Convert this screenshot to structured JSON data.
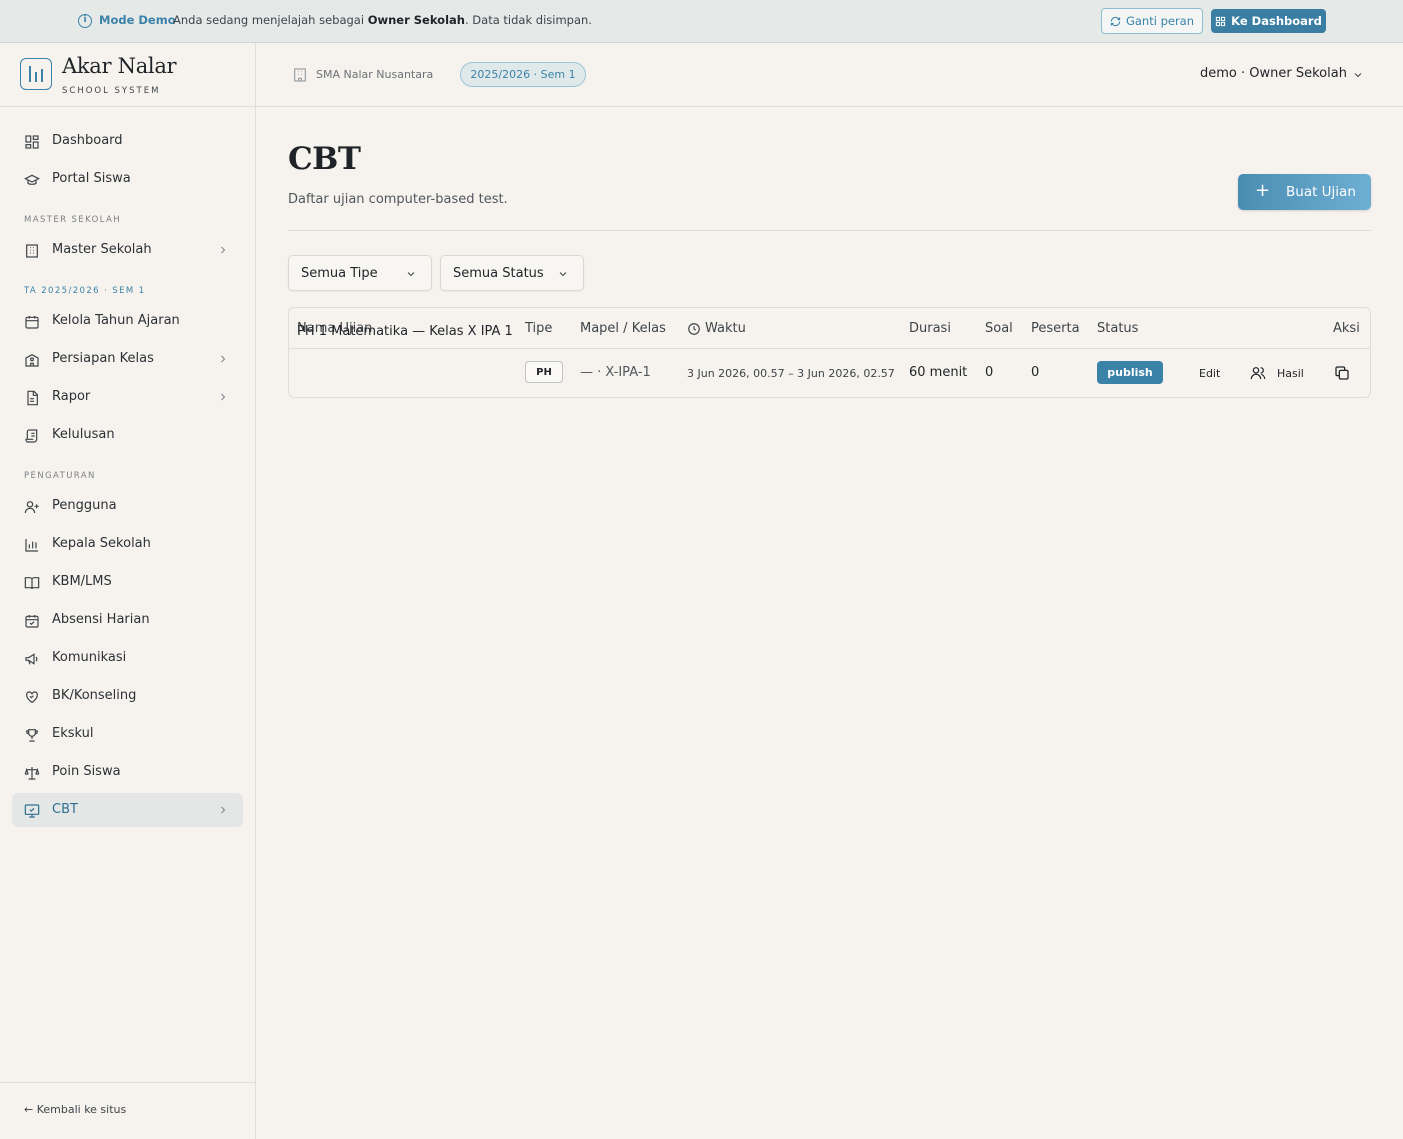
{
  "banner": {
    "mode_label": "Mode Demo",
    "message_prefix": "Anda sedang menjelajah sebagai ",
    "role": "Owner Sekolah",
    "message_suffix": ". Data tidak disimpan.",
    "switch_role": "Ganti peran",
    "to_dashboard": "Ke Dashboard"
  },
  "brand": {
    "name": "Akar Nalar",
    "subtitle": "SCHOOL SYSTEM"
  },
  "sidebar": {
    "items": [
      {
        "label": "Dashboard",
        "icon": "dashboard-icon"
      },
      {
        "label": "Portal Siswa",
        "icon": "graduation-cap-icon"
      },
      {
        "label": "Master Sekolah",
        "icon": "building-icon"
      },
      {
        "label": "Kelola Tahun Ajaran",
        "icon": "calendar-icon"
      },
      {
        "label": "Persiapan Kelas",
        "icon": "school-icon"
      },
      {
        "label": "Rapor",
        "icon": "file-text-icon"
      },
      {
        "label": "Kelulusan",
        "icon": "scroll-icon"
      },
      {
        "label": "Pengguna",
        "icon": "user-plus-icon"
      },
      {
        "label": "Kepala Sekolah",
        "icon": "bar-chart-icon"
      },
      {
        "label": "KBM/LMS",
        "icon": "book-open-icon"
      },
      {
        "label": "Absensi Harian",
        "icon": "calendar-check-icon"
      },
      {
        "label": "Komunikasi",
        "icon": "megaphone-icon"
      },
      {
        "label": "BK/Konseling",
        "icon": "heart-handshake-icon"
      },
      {
        "label": "Ekskul",
        "icon": "trophy-icon"
      },
      {
        "label": "Poin Siswa",
        "icon": "scale-icon"
      },
      {
        "label": "CBT",
        "icon": "monitor-check-icon"
      }
    ],
    "sections": [
      "MASTER SEKOLAH",
      "TA 2025/2026 · SEM 1",
      "PENGATURAN"
    ],
    "back": "← Kembali ke situs"
  },
  "topbar": {
    "school": "SMA Nalar Nusantara",
    "year": "2025/2026 · Sem 1",
    "user": "demo · Owner Sekolah"
  },
  "page": {
    "title": "CBT",
    "subtitle": "Daftar ujian computer-based test.",
    "create_button": "Buat Ujian"
  },
  "filters": {
    "type": "Semua Tipe",
    "status": "Semua Status"
  },
  "table": {
    "headers": [
      "Nama Ujian",
      "Tipe",
      "Mapel / Kelas",
      "Waktu",
      "Durasi",
      "Soal",
      "Peserta",
      "Status",
      "Aksi"
    ],
    "rows": [
      {
        "name": "PH 1 Matematika — Kelas X IPA 1",
        "type": "PH",
        "subject_class": "— · X-IPA-1",
        "time": "3 Jun 2026, 00.57 – 3 Jun 2026, 02.57",
        "duration": "60 menit",
        "questions": "0",
        "participants": "0",
        "status": "publish",
        "edit": "Edit",
        "results": "Hasil"
      }
    ]
  },
  "colors": {
    "accent": "#3b82a8",
    "background": "#f6f3ee",
    "active_bg": "#e4e7e6"
  }
}
